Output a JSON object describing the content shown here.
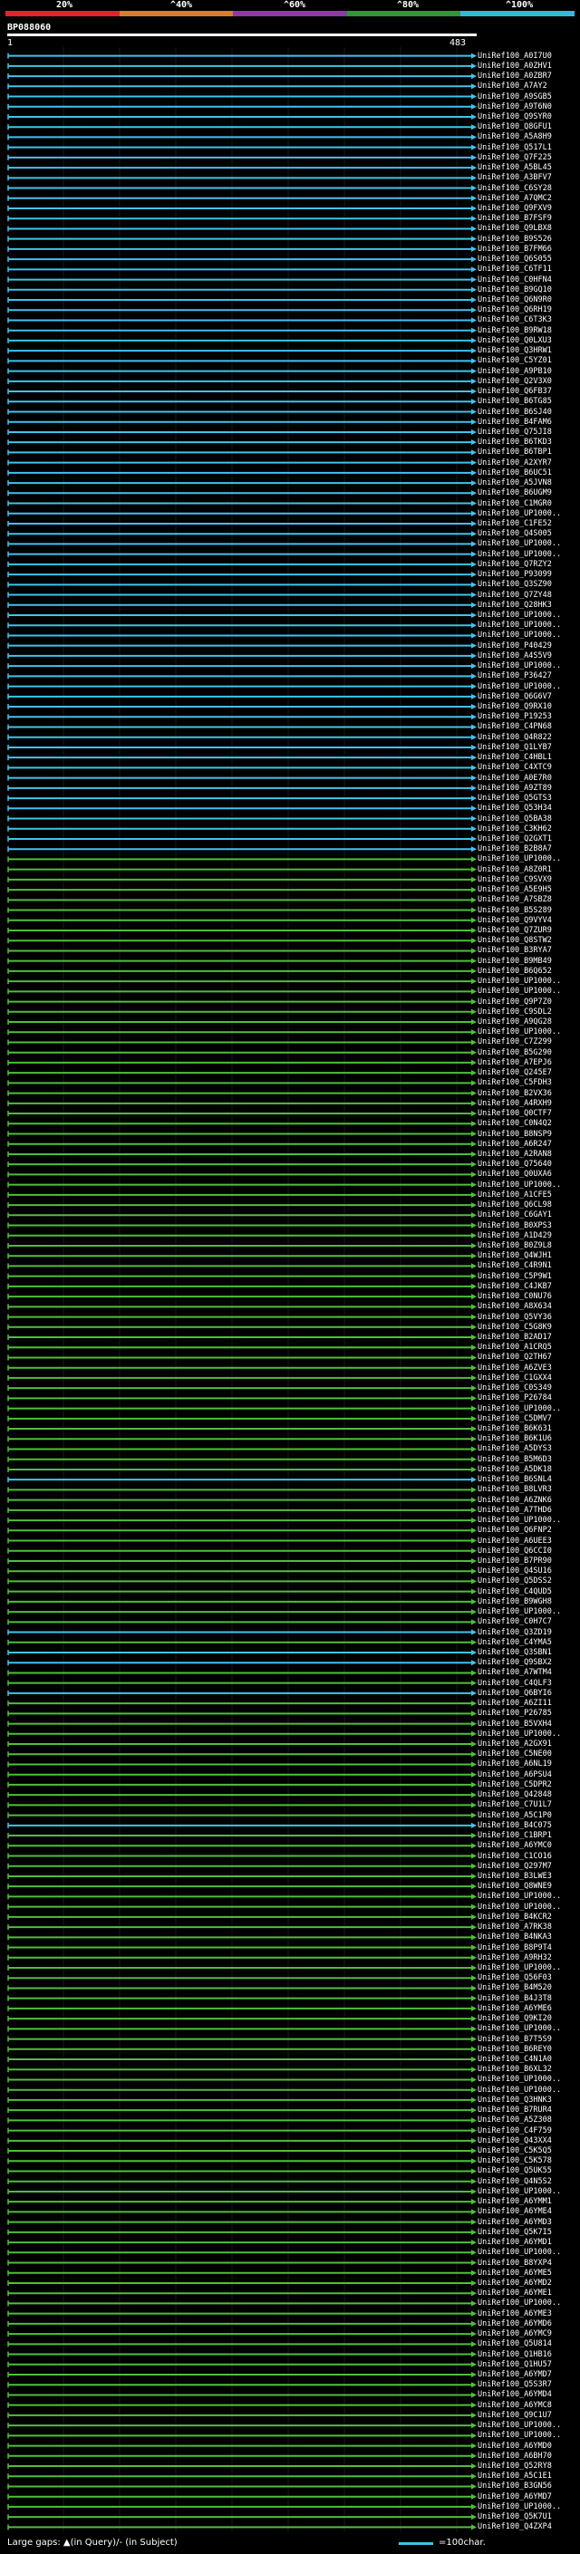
{
  "legend": {
    "labels": [
      "20%",
      "^40%",
      "^60%",
      "^80%",
      "^100%"
    ],
    "colors": [
      "#e0262b",
      "#e07a24",
      "#8e3aa5",
      "#2a9a36",
      "#34b7dc"
    ]
  },
  "query": {
    "name": "BP088060",
    "start": "1",
    "end": "483"
  },
  "footer": {
    "gaps_text": "Large gaps: ▲(in Query)/- (in Subject)",
    "scale_text": "=100char."
  },
  "hit_colors": {
    "cyan": "#40c4ec",
    "green": "#4fbf3a"
  },
  "hits": [
    {
      "label": "UniRef100_A0I7U0",
      "color": "cyan"
    },
    {
      "label": "UniRef100_A0ZHV1",
      "color": "cyan"
    },
    {
      "label": "UniRef100_A0ZBR7",
      "color": "cyan"
    },
    {
      "label": "UniRef100_A7AY2",
      "color": "cyan"
    },
    {
      "label": "UniRef100_A9SGB5",
      "color": "cyan"
    },
    {
      "label": "UniRef100_A9T6N0",
      "color": "cyan"
    },
    {
      "label": "UniRef100_Q9SYR0",
      "color": "cyan"
    },
    {
      "label": "UniRef100_Q8GFU1",
      "color": "cyan"
    },
    {
      "label": "UniRef100_A5A8H9",
      "color": "cyan"
    },
    {
      "label": "UniRef100_Q517L1",
      "color": "cyan"
    },
    {
      "label": "UniRef100_Q7F225",
      "color": "cyan"
    },
    {
      "label": "UniRef100_A5BL45",
      "color": "cyan"
    },
    {
      "label": "UniRef100_A3BFV7",
      "color": "cyan"
    },
    {
      "label": "UniRef100_C6SY28",
      "color": "cyan"
    },
    {
      "label": "UniRef100_A7QMC2",
      "color": "cyan"
    },
    {
      "label": "UniRef100_Q9FXV9",
      "color": "cyan"
    },
    {
      "label": "UniRef100_B7FSF9",
      "color": "cyan"
    },
    {
      "label": "UniRef100_Q9LBX8",
      "color": "cyan"
    },
    {
      "label": "UniRef100_B9S526",
      "color": "cyan"
    },
    {
      "label": "UniRef100_B7FM66",
      "color": "cyan"
    },
    {
      "label": "UniRef100_Q6S055",
      "color": "cyan"
    },
    {
      "label": "UniRef100_C6TF11",
      "color": "cyan"
    },
    {
      "label": "UniRef100_C0HFN4",
      "color": "cyan"
    },
    {
      "label": "UniRef100_B9GQ10",
      "color": "cyan"
    },
    {
      "label": "UniRef100_Q6N9R0",
      "color": "cyan"
    },
    {
      "label": "UniRef100_Q6RH19",
      "color": "cyan"
    },
    {
      "label": "UniRef100_C6T3K3",
      "color": "cyan"
    },
    {
      "label": "UniRef100_B9RW18",
      "color": "cyan"
    },
    {
      "label": "UniRef100_Q0LXU3",
      "color": "cyan"
    },
    {
      "label": "UniRef100_Q3HRW1",
      "color": "cyan"
    },
    {
      "label": "UniRef100_C5YZ01",
      "color": "cyan"
    },
    {
      "label": "UniRef100_A9PB10",
      "color": "cyan"
    },
    {
      "label": "UniRef100_Q2V3X0",
      "color": "cyan"
    },
    {
      "label": "UniRef100_Q6FB37",
      "color": "cyan"
    },
    {
      "label": "UniRef100_B6TG85",
      "color": "cyan"
    },
    {
      "label": "UniRef100_B6SJ40",
      "color": "cyan"
    },
    {
      "label": "UniRef100_B4FAM6",
      "color": "cyan"
    },
    {
      "label": "UniRef100_Q75JI8",
      "color": "cyan"
    },
    {
      "label": "UniRef100_B6TKD3",
      "color": "cyan"
    },
    {
      "label": "UniRef100_B6TBP1",
      "color": "cyan"
    },
    {
      "label": "UniRef100_A2XYR7",
      "color": "cyan"
    },
    {
      "label": "UniRef100_B6UC51",
      "color": "cyan"
    },
    {
      "label": "UniRef100_A5JVN8",
      "color": "cyan"
    },
    {
      "label": "UniRef100_B6UGM9",
      "color": "cyan"
    },
    {
      "label": "UniRef100_C1MGR0",
      "color": "cyan"
    },
    {
      "label": "UniRef100_UP1000..",
      "color": "cyan"
    },
    {
      "label": "UniRef100_C1FE52",
      "color": "cyan"
    },
    {
      "label": "UniRef100_Q4S005",
      "color": "cyan"
    },
    {
      "label": "UniRef100_UP1000..",
      "color": "cyan"
    },
    {
      "label": "UniRef100_UP1000..",
      "color": "cyan"
    },
    {
      "label": "UniRef100_Q7RZY2",
      "color": "cyan"
    },
    {
      "label": "UniRef100_P93099",
      "color": "cyan"
    },
    {
      "label": "UniRef100_Q3SZ90",
      "color": "cyan"
    },
    {
      "label": "UniRef100_Q7ZY48",
      "color": "cyan"
    },
    {
      "label": "UniRef100_Q28HK3",
      "color": "cyan"
    },
    {
      "label": "UniRef100_UP1000..",
      "color": "cyan"
    },
    {
      "label": "UniRef100_UP1000..",
      "color": "cyan"
    },
    {
      "label": "UniRef100_UP1000..",
      "color": "cyan"
    },
    {
      "label": "UniRef100_P40429",
      "color": "cyan"
    },
    {
      "label": "UniRef100_A4S5V9",
      "color": "cyan"
    },
    {
      "label": "UniRef100_UP1000..",
      "color": "cyan"
    },
    {
      "label": "UniRef100_P36427",
      "color": "cyan"
    },
    {
      "label": "UniRef100_UP1000..",
      "color": "cyan"
    },
    {
      "label": "UniRef100_Q6G6V7",
      "color": "cyan"
    },
    {
      "label": "UniRef100_Q9RX10",
      "color": "cyan"
    },
    {
      "label": "UniRef100_P19253",
      "color": "cyan"
    },
    {
      "label": "UniRef100_C4PN68",
      "color": "cyan"
    },
    {
      "label": "UniRef100_Q4R822",
      "color": "cyan"
    },
    {
      "label": "UniRef100_Q1LYB7",
      "color": "cyan"
    },
    {
      "label": "UniRef100_C4HBL1",
      "color": "cyan"
    },
    {
      "label": "UniRef100_C4XTC9",
      "color": "cyan"
    },
    {
      "label": "UniRef100_A0E7R0",
      "color": "cyan"
    },
    {
      "label": "UniRef100_A9ZT89",
      "color": "cyan"
    },
    {
      "label": "UniRef100_Q5GTS3",
      "color": "cyan"
    },
    {
      "label": "UniRef100_Q53H34",
      "color": "cyan"
    },
    {
      "label": "UniRef100_Q5BA38",
      "color": "cyan"
    },
    {
      "label": "UniRef100_C3KH62",
      "color": "cyan"
    },
    {
      "label": "UniRef100_Q2GXT1",
      "color": "cyan"
    },
    {
      "label": "UniRef100_B2B8A7",
      "color": "cyan"
    },
    {
      "label": "UniRef100_UP1000..",
      "color": "green"
    },
    {
      "label": "UniRef100_A8Z0R1",
      "color": "green"
    },
    {
      "label": "UniRef100_C9SVX9",
      "color": "green"
    },
    {
      "label": "UniRef100_A5E9H5",
      "color": "green"
    },
    {
      "label": "UniRef100_A7SBZ8",
      "color": "green"
    },
    {
      "label": "UniRef100_B5S289",
      "color": "green"
    },
    {
      "label": "UniRef100_Q9VYV4",
      "color": "green"
    },
    {
      "label": "UniRef100_Q7ZUR9",
      "color": "green"
    },
    {
      "label": "UniRef100_Q8STW2",
      "color": "green"
    },
    {
      "label": "UniRef100_B3RYA7",
      "color": "green"
    },
    {
      "label": "UniRef100_B9MB49",
      "color": "green"
    },
    {
      "label": "UniRef100_B6Q652",
      "color": "green"
    },
    {
      "label": "UniRef100_UP1000..",
      "color": "green"
    },
    {
      "label": "UniRef100_UP1000..",
      "color": "green"
    },
    {
      "label": "UniRef100_Q9P7Z0",
      "color": "green"
    },
    {
      "label": "UniRef100_C9SDL2",
      "color": "green"
    },
    {
      "label": "UniRef100_A9QG28",
      "color": "green"
    },
    {
      "label": "UniRef100_UP1000..",
      "color": "green"
    },
    {
      "label": "UniRef100_C7Z299",
      "color": "green"
    },
    {
      "label": "UniRef100_B5G290",
      "color": "green"
    },
    {
      "label": "UniRef100_A7EPJ6",
      "color": "green"
    },
    {
      "label": "UniRef100_Q245E7",
      "color": "green"
    },
    {
      "label": "UniRef100_C5FDH3",
      "color": "green"
    },
    {
      "label": "UniRef100_B2VX36",
      "color": "green"
    },
    {
      "label": "UniRef100_A4RXH9",
      "color": "green"
    },
    {
      "label": "UniRef100_Q0CTF7",
      "color": "green"
    },
    {
      "label": "UniRef100_C0N4Q2",
      "color": "green"
    },
    {
      "label": "UniRef100_B8NSP9",
      "color": "green"
    },
    {
      "label": "UniRef100_A6R247",
      "color": "green"
    },
    {
      "label": "UniRef100_A2RAN8",
      "color": "green"
    },
    {
      "label": "UniRef100_Q75640",
      "color": "green"
    },
    {
      "label": "UniRef100_Q0UXA6",
      "color": "green"
    },
    {
      "label": "UniRef100_UP1000..",
      "color": "green"
    },
    {
      "label": "UniRef100_A1CFE5",
      "color": "green"
    },
    {
      "label": "UniRef100_Q6CL98",
      "color": "green"
    },
    {
      "label": "UniRef100_C6GAY1",
      "color": "green"
    },
    {
      "label": "UniRef100_B0XPS3",
      "color": "green"
    },
    {
      "label": "UniRef100_A1D429",
      "color": "green"
    },
    {
      "label": "UniRef100_B0Z9L8",
      "color": "green"
    },
    {
      "label": "UniRef100_Q4WJH1",
      "color": "green"
    },
    {
      "label": "UniRef100_C4R9N1",
      "color": "green"
    },
    {
      "label": "UniRef100_C5P9W1",
      "color": "green"
    },
    {
      "label": "UniRef100_C4JKB7",
      "color": "green"
    },
    {
      "label": "UniRef100_C0NU76",
      "color": "green"
    },
    {
      "label": "UniRef100_A8X634",
      "color": "green"
    },
    {
      "label": "UniRef100_Q5VY36",
      "color": "green"
    },
    {
      "label": "UniRef100_C5G8K9",
      "color": "green"
    },
    {
      "label": "UniRef100_B2AD17",
      "color": "green"
    },
    {
      "label": "UniRef100_A1CRQ5",
      "color": "green"
    },
    {
      "label": "UniRef100_Q2TH67",
      "color": "green"
    },
    {
      "label": "UniRef100_A6ZVE3",
      "color": "green"
    },
    {
      "label": "UniRef100_C1GXX4",
      "color": "green"
    },
    {
      "label": "UniRef100_C0S349",
      "color": "green"
    },
    {
      "label": "UniRef100_P26784",
      "color": "green"
    },
    {
      "label": "UniRef100_UP1000..",
      "color": "green"
    },
    {
      "label": "UniRef100_C5DMV7",
      "color": "green"
    },
    {
      "label": "UniRef100_B6K631",
      "color": "green"
    },
    {
      "label": "UniRef100_B6K1U6",
      "color": "green"
    },
    {
      "label": "UniRef100_A5DYS3",
      "color": "green"
    },
    {
      "label": "UniRef100_B5M6D3",
      "color": "green"
    },
    {
      "label": "UniRef100_A5DK18",
      "color": "green"
    },
    {
      "label": "UniRef100_B6SNL4",
      "color": "cyan"
    },
    {
      "label": "UniRef100_B8LVR3",
      "color": "green"
    },
    {
      "label": "UniRef100_A6ZNK6",
      "color": "green"
    },
    {
      "label": "UniRef100_A7THD6",
      "color": "green"
    },
    {
      "label": "UniRef100_UP1000..",
      "color": "green"
    },
    {
      "label": "UniRef100_Q6FNP2",
      "color": "green"
    },
    {
      "label": "UniRef100_A6UEE3",
      "color": "green"
    },
    {
      "label": "UniRef100_Q6CCI0",
      "color": "green"
    },
    {
      "label": "UniRef100_B7PR90",
      "color": "green"
    },
    {
      "label": "UniRef100_Q4SU16",
      "color": "green"
    },
    {
      "label": "UniRef100_Q5DSS2",
      "color": "green"
    },
    {
      "label": "UniRef100_C4QUD5",
      "color": "green"
    },
    {
      "label": "UniRef100_B9WGH8",
      "color": "green"
    },
    {
      "label": "UniRef100_UP1000..",
      "color": "green"
    },
    {
      "label": "UniRef100_C0H7C7",
      "color": "green"
    },
    {
      "label": "UniRef100_Q3ZD19",
      "color": "cyan"
    },
    {
      "label": "UniRef100_C4YMA5",
      "color": "green"
    },
    {
      "label": "UniRef100_Q3SBN1",
      "color": "cyan"
    },
    {
      "label": "UniRef100_Q9SBX2",
      "color": "cyan"
    },
    {
      "label": "UniRef100_A7WTM4",
      "color": "green"
    },
    {
      "label": "UniRef100_C4QLF3",
      "color": "green"
    },
    {
      "label": "UniRef100_Q6BYI6",
      "color": "cyan"
    },
    {
      "label": "UniRef100_A6ZI11",
      "color": "green"
    },
    {
      "label": "UniRef100_P26785",
      "color": "green"
    },
    {
      "label": "UniRef100_B5VXH4",
      "color": "green"
    },
    {
      "label": "UniRef100_UP1000..",
      "color": "green"
    },
    {
      "label": "UniRef100_A2GX91",
      "color": "green"
    },
    {
      "label": "UniRef100_C5NE00",
      "color": "green"
    },
    {
      "label": "UniRef100_A6NL19",
      "color": "green"
    },
    {
      "label": "UniRef100_A6PSU4",
      "color": "green"
    },
    {
      "label": "UniRef100_C5DPR2",
      "color": "green"
    },
    {
      "label": "UniRef100_Q42848",
      "color": "green"
    },
    {
      "label": "UniRef100_C7U1L7",
      "color": "green"
    },
    {
      "label": "UniRef100_A5C1P0",
      "color": "green"
    },
    {
      "label": "UniRef100_B4C075",
      "color": "cyan"
    },
    {
      "label": "UniRef100_C1BRP1",
      "color": "green"
    },
    {
      "label": "UniRef100_A6YMC0",
      "color": "green"
    },
    {
      "label": "UniRef100_C1CO16",
      "color": "green"
    },
    {
      "label": "UniRef100_Q297M7",
      "color": "green"
    },
    {
      "label": "UniRef100_B3LWE3",
      "color": "green"
    },
    {
      "label": "UniRef100_Q8WNE9",
      "color": "green"
    },
    {
      "label": "UniRef100_UP1000..",
      "color": "green"
    },
    {
      "label": "UniRef100_UP1000..",
      "color": "green"
    },
    {
      "label": "UniRef100_B4KCR2",
      "color": "green"
    },
    {
      "label": "UniRef100_A7RK38",
      "color": "green"
    },
    {
      "label": "UniRef100_B4NKA3",
      "color": "green"
    },
    {
      "label": "UniRef100_B8P9T4",
      "color": "green"
    },
    {
      "label": "UniRef100_A9RH32",
      "color": "green"
    },
    {
      "label": "UniRef100_UP1000..",
      "color": "green"
    },
    {
      "label": "UniRef100_Q56F03",
      "color": "green"
    },
    {
      "label": "UniRef100_B4M520",
      "color": "green"
    },
    {
      "label": "UniRef100_B4J3T8",
      "color": "green"
    },
    {
      "label": "UniRef100_A6YME6",
      "color": "green"
    },
    {
      "label": "UniRef100_Q9KI20",
      "color": "green"
    },
    {
      "label": "UniRef100_UP1000..",
      "color": "green"
    },
    {
      "label": "UniRef100_B7T5S9",
      "color": "green"
    },
    {
      "label": "UniRef100_B6REY0",
      "color": "green"
    },
    {
      "label": "UniRef100_C4N1A0",
      "color": "green"
    },
    {
      "label": "UniRef100_B6XL32",
      "color": "green"
    },
    {
      "label": "UniRef100_UP1000..",
      "color": "green"
    },
    {
      "label": "UniRef100_UP1000..",
      "color": "green"
    },
    {
      "label": "UniRef100_Q3HNK3",
      "color": "green"
    },
    {
      "label": "UniRef100_B7RUR4",
      "color": "green"
    },
    {
      "label": "UniRef100_A5Z308",
      "color": "green"
    },
    {
      "label": "UniRef100_C4F759",
      "color": "green"
    },
    {
      "label": "UniRef100_Q43XX4",
      "color": "green"
    },
    {
      "label": "UniRef100_C5K5Q5",
      "color": "green"
    },
    {
      "label": "UniRef100_C5K578",
      "color": "green"
    },
    {
      "label": "UniRef100_Q5UK55",
      "color": "green"
    },
    {
      "label": "UniRef100_Q4N5S2",
      "color": "green"
    },
    {
      "label": "UniRef100_UP1000..",
      "color": "green"
    },
    {
      "label": "UniRef100_A6YMM1",
      "color": "green"
    },
    {
      "label": "UniRef100_A6YME4",
      "color": "green"
    },
    {
      "label": "UniRef100_A6YMD3",
      "color": "green"
    },
    {
      "label": "UniRef100_Q5K7I5",
      "color": "green"
    },
    {
      "label": "UniRef100_A6YMD1",
      "color": "green"
    },
    {
      "label": "UniRef100_UP1000..",
      "color": "green"
    },
    {
      "label": "UniRef100_B8YXP4",
      "color": "green"
    },
    {
      "label": "UniRef100_A6YME5",
      "color": "green"
    },
    {
      "label": "UniRef100_A6YMD2",
      "color": "green"
    },
    {
      "label": "UniRef100_A6YME1",
      "color": "green"
    },
    {
      "label": "UniRef100_UP1000..",
      "color": "green"
    },
    {
      "label": "UniRef100_A6YME3",
      "color": "green"
    },
    {
      "label": "UniRef100_A6YMD6",
      "color": "green"
    },
    {
      "label": "UniRef100_A6YMC9",
      "color": "green"
    },
    {
      "label": "UniRef100_Q5U814",
      "color": "green"
    },
    {
      "label": "UniRef100_Q1HB16",
      "color": "green"
    },
    {
      "label": "UniRef100_Q1HU57",
      "color": "green"
    },
    {
      "label": "UniRef100_A6YMD7",
      "color": "green"
    },
    {
      "label": "UniRef100_Q5S3R7",
      "color": "green"
    },
    {
      "label": "UniRef100_A6YMD4",
      "color": "green"
    },
    {
      "label": "UniRef100_A6YMC8",
      "color": "green"
    },
    {
      "label": "UniRef100_Q9C1U7",
      "color": "green"
    },
    {
      "label": "UniRef100_UP1000..",
      "color": "green"
    },
    {
      "label": "UniRef100_UP1000..",
      "color": "green"
    },
    {
      "label": "UniRef100_A6YMD0",
      "color": "green"
    },
    {
      "label": "UniRef100_A6BH70",
      "color": "green"
    },
    {
      "label": "UniRef100_Q52RY8",
      "color": "green"
    },
    {
      "label": "UniRef100_A5C1E1",
      "color": "green"
    },
    {
      "label": "UniRef100_B3GN56",
      "color": "green"
    },
    {
      "label": "UniRef100_A6YMD7",
      "color": "green"
    },
    {
      "label": "UniRef100_UP1000..",
      "color": "green"
    },
    {
      "label": "UniRef100_Q5K7U1",
      "color": "green"
    },
    {
      "label": "UniRef100_Q4ZXP4",
      "color": "green"
    }
  ]
}
